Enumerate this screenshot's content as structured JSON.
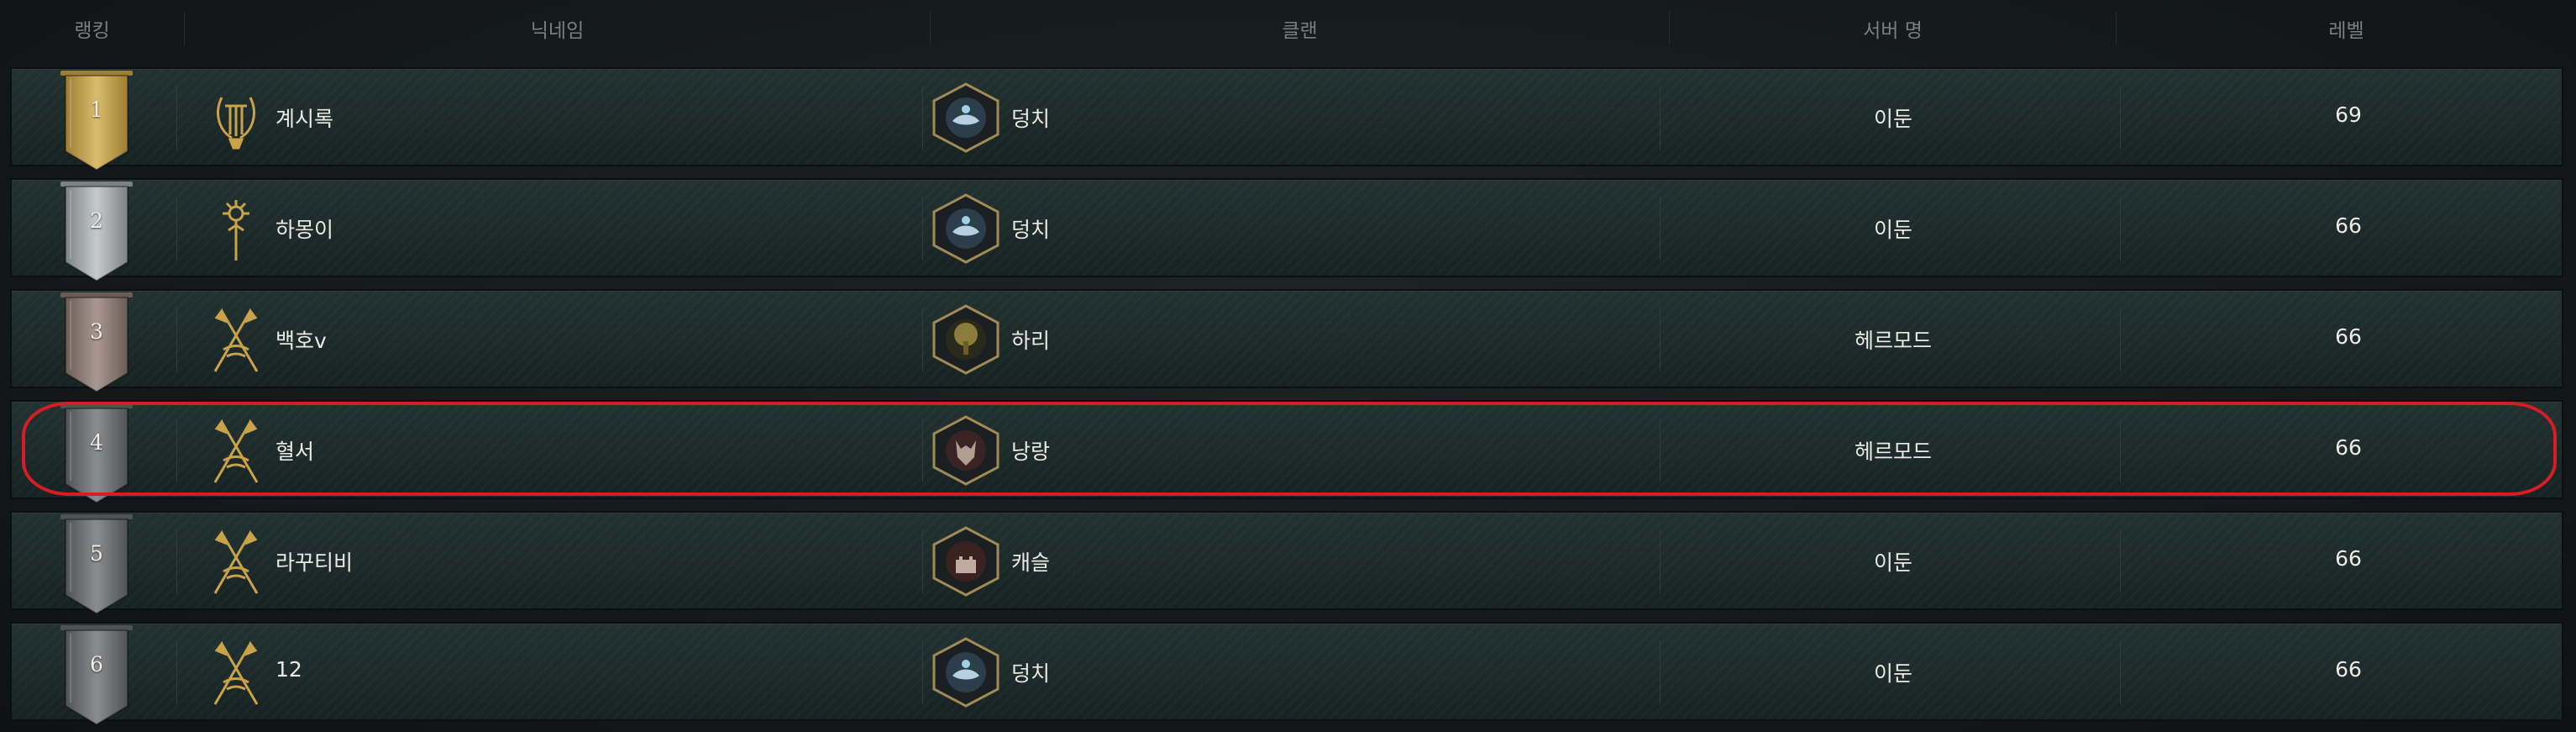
{
  "header": {
    "rank": "랭킹",
    "nickname": "닉네임",
    "clan": "클랜",
    "server": "서버 명",
    "level": "레벨"
  },
  "rows": [
    {
      "rank": "1",
      "nickname": "계시록",
      "class_icon": "lyre-icon",
      "clan": "덩치",
      "clan_emblem": "blue-crest-emblem",
      "server": "이둔",
      "level": "69",
      "banner": "gold"
    },
    {
      "rank": "2",
      "nickname": "하몽이",
      "class_icon": "staff-icon",
      "clan": "덩치",
      "clan_emblem": "blue-crest-emblem",
      "server": "이둔",
      "level": "66",
      "banner": "silver"
    },
    {
      "rank": "3",
      "nickname": "백호v",
      "class_icon": "crossed-spears-icon",
      "clan": "하리",
      "clan_emblem": "tree-emblem",
      "server": "헤르모드",
      "level": "66",
      "banner": "bronze"
    },
    {
      "rank": "4",
      "nickname": "혈서",
      "class_icon": "crossed-spears-icon",
      "clan": "낭랑",
      "clan_emblem": "wolf-emblem",
      "server": "헤르모드",
      "level": "66",
      "banner": "gray"
    },
    {
      "rank": "5",
      "nickname": "라꾸티비",
      "class_icon": "crossed-spears-icon",
      "clan": "캐슬",
      "clan_emblem": "castle-emblem",
      "server": "이둔",
      "level": "66",
      "banner": "gray"
    },
    {
      "rank": "6",
      "nickname": "12",
      "class_icon": "crossed-spears-icon",
      "clan": "덩치",
      "clan_emblem": "blue-crest-emblem",
      "server": "이둔",
      "level": "66",
      "banner": "gray"
    }
  ],
  "colors": {
    "gold": "#b8974a",
    "silver": "#9ea3a6",
    "bronze": "#8c7b73",
    "gray": "#6c6e70",
    "highlight": "#d51d24",
    "class_icon": "#c9a24a"
  }
}
